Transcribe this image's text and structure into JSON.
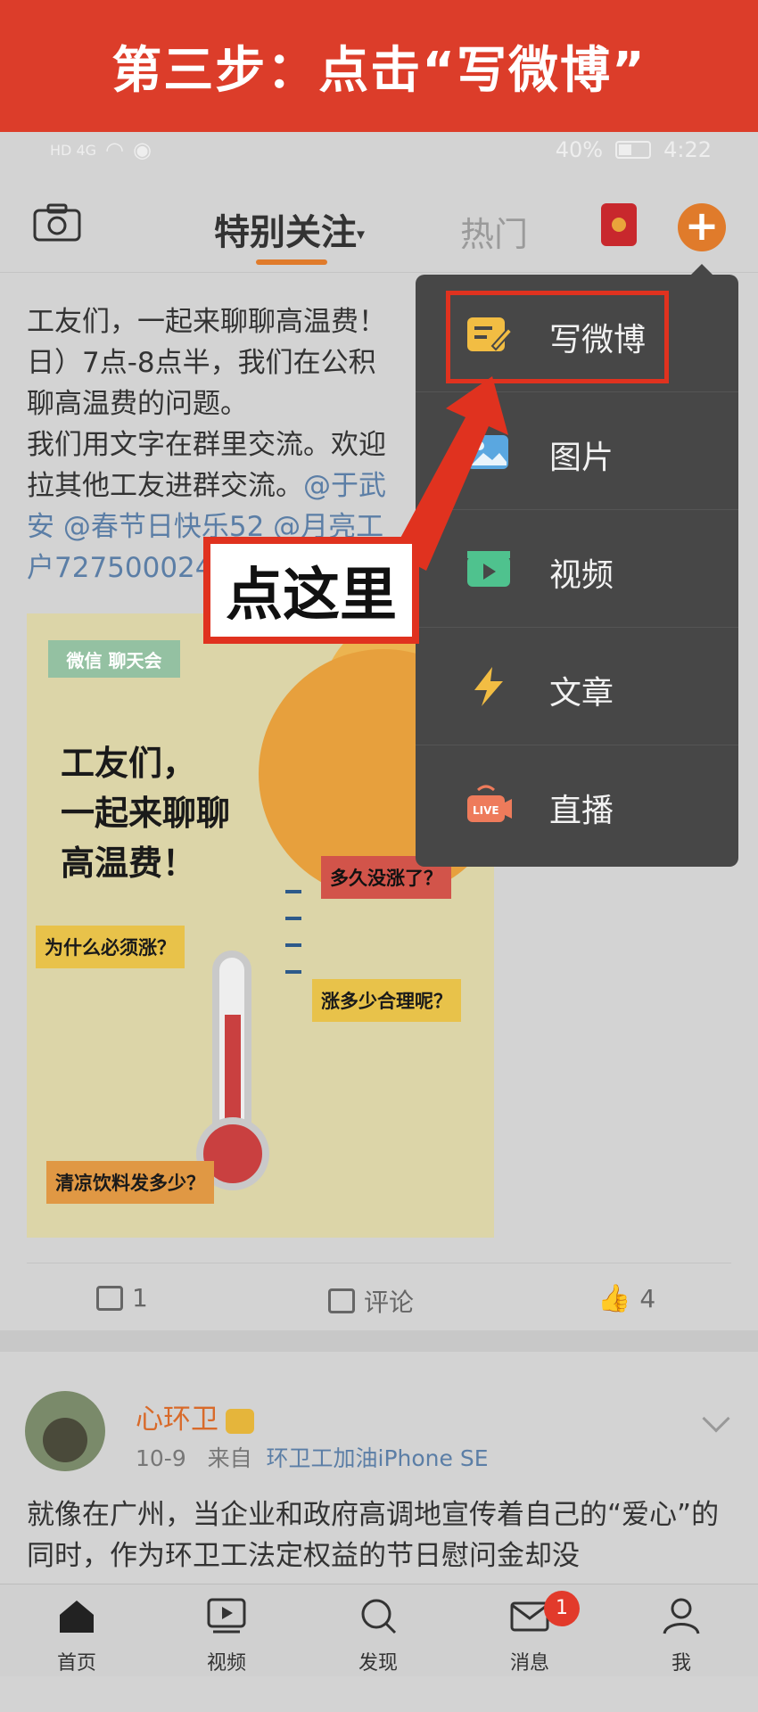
{
  "banner": {
    "text": "第三步：点击“写微博”"
  },
  "status_bar": {
    "signal_label": "HD 4G",
    "battery": "40%",
    "time": "4:22"
  },
  "header": {
    "tabs": [
      {
        "label": "特别关注",
        "caret": "▾",
        "active": true
      },
      {
        "label": "热门",
        "active": false
      }
    ],
    "plus_symbol": "+"
  },
  "post1": {
    "lines": [
      "工友们，一起来聊聊高温费！",
      "日）7点-8点半，我们在公积",
      "聊高温费的问题。",
      "我们用文字在群里交流。欢迎",
      "拉其他工友进群交流。"
    ],
    "mention1": "@于武",
    "mention2": "安 @春节日快乐52 @月亮工",
    "mention3": "户727500024",
    "image": {
      "tag": "微信 聊天会",
      "title": "工友们，\n一起来聊聊\n高温费！",
      "bubbles": [
        "多久没涨了？",
        "为什么必须涨？",
        "涨多少合理呢？",
        "清凉饮料发多少？"
      ]
    },
    "actions": {
      "repost_count": "1",
      "comment_label": "评论",
      "like_count": "4"
    }
  },
  "post2": {
    "author": "心环卫",
    "date": "10-9",
    "from_label": "来自",
    "source": "环卫工加油iPhone SE",
    "text": "就像在广州，当企业和政府高调地宣传着自己的“爱心”的同时，作为环卫工法定权益的节日慰问金却没"
  },
  "dropdown": {
    "items": [
      {
        "label": "写微博",
        "icon": "write-weibo-icon"
      },
      {
        "label": "图片",
        "icon": "picture-icon"
      },
      {
        "label": "视频",
        "icon": "video-icon"
      },
      {
        "label": "文章",
        "icon": "article-icon"
      },
      {
        "label": "直播",
        "icon": "live-icon"
      }
    ]
  },
  "annotation": {
    "callout": "点这里"
  },
  "tabbar": {
    "items": [
      {
        "label": "首页",
        "icon": "home-icon"
      },
      {
        "label": "视频",
        "icon": "video-tab-icon"
      },
      {
        "label": "发现",
        "icon": "search-icon"
      },
      {
        "label": "消息",
        "icon": "mail-icon"
      },
      {
        "label": "我",
        "icon": "user-icon"
      }
    ],
    "message_badge": "1"
  },
  "colors": {
    "accent": "#e07b2b",
    "banner_red": "#dc3d2a",
    "highlight_red": "#e0321f",
    "menu_bg": "#474747",
    "link_blue": "#5b7ea6"
  }
}
